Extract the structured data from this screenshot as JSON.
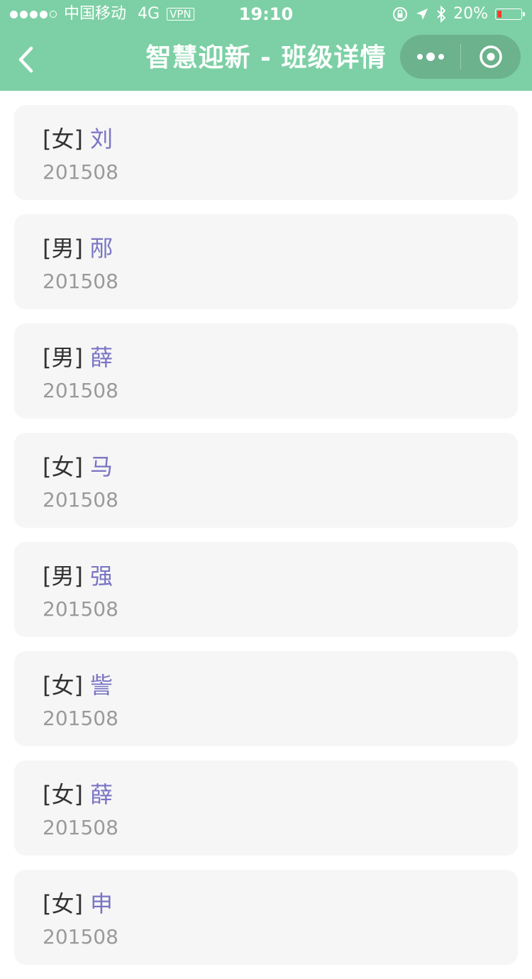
{
  "status_bar": {
    "carrier": "中国移动",
    "network": "4G",
    "vpn": "VPN",
    "time": "19:10",
    "battery_percent": "20%",
    "battery_level": 0.2,
    "battery_color": "#ff3b30"
  },
  "nav": {
    "title": "智慧迎新 - 班级详情",
    "back_icon": "chevron-left-icon",
    "more_icon": "more-dots-icon",
    "close_icon": "target-circle-icon"
  },
  "colors": {
    "header_bg": "#7dd0a5",
    "name_color": "#7a74c4",
    "card_bg": "#f6f6f6"
  },
  "students": [
    {
      "gender": "[女]",
      "name": "刘",
      "id": "201508"
    },
    {
      "gender": "[男]",
      "name": "邴",
      "id": "201508"
    },
    {
      "gender": "[男]",
      "name": "薛",
      "id": "201508"
    },
    {
      "gender": "[女]",
      "name": "马",
      "id": "201508"
    },
    {
      "gender": "[男]",
      "name": "强",
      "id": "201508"
    },
    {
      "gender": "[女]",
      "name": "訾",
      "id": "201508"
    },
    {
      "gender": "[女]",
      "name": "薛",
      "id": "201508"
    },
    {
      "gender": "[女]",
      "name": "申",
      "id": "201508"
    }
  ]
}
